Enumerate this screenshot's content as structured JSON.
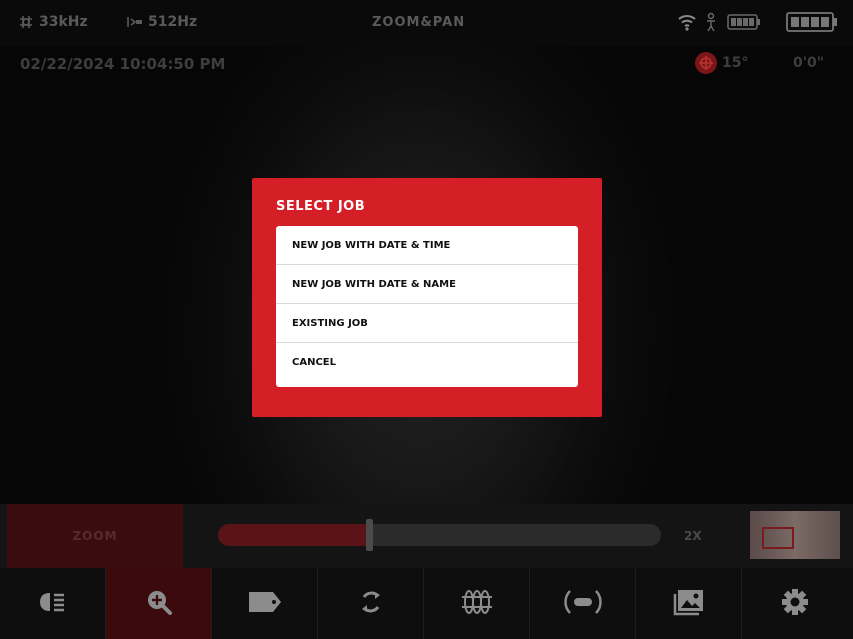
{
  "status_bar": {
    "frequency": "33kHz",
    "sonde": "512Hz",
    "mode_title": "ZOOM&PAN"
  },
  "overlay": {
    "datetime": "02/22/2024 10:04:50 PM",
    "tilt": "15°",
    "distance": "0'0\""
  },
  "dialog": {
    "title": "SELECT JOB",
    "options": [
      {
        "label": "NEW JOB WITH DATE & TIME"
      },
      {
        "label": "NEW JOB WITH DATE & NAME"
      },
      {
        "label": "EXISTING JOB"
      },
      {
        "label": "CANCEL"
      }
    ]
  },
  "zoom_control": {
    "label": "ZOOM",
    "value_label": "2X",
    "level_fraction": 0.34
  },
  "nav": {
    "items": [
      {
        "icon": "light-icon",
        "active": false
      },
      {
        "icon": "zoom-in-icon",
        "active": true
      },
      {
        "icon": "tag-icon",
        "active": false
      },
      {
        "icon": "rotate-icon",
        "active": false
      },
      {
        "icon": "sonde-icon",
        "active": false
      },
      {
        "icon": "locate-icon",
        "active": false
      },
      {
        "icon": "gallery-icon",
        "active": false
      },
      {
        "icon": "settings-icon",
        "active": false
      }
    ]
  },
  "colors": {
    "accent": "#d41f26",
    "active_nav": "#3a0a0c"
  }
}
